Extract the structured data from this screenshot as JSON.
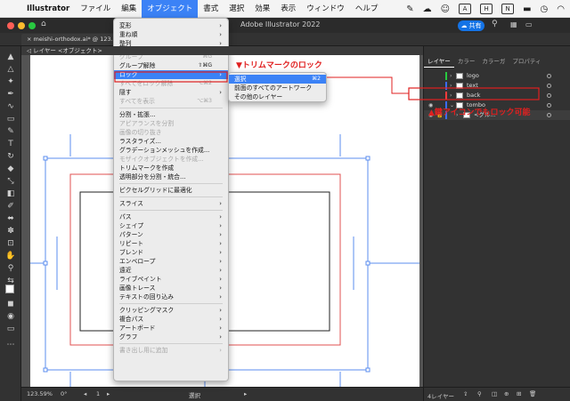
{
  "menubar": {
    "app": "Illustrator",
    "items": [
      "ファイル",
      "編集",
      "オブジェクト",
      "書式",
      "選択",
      "効果",
      "表示",
      "ウィンドウ",
      "ヘルプ"
    ],
    "active_index": 2
  },
  "window": {
    "title": "Adobe Illustrator 2022",
    "doc_tab": "meishi-orthodox.ai* @ 123.59 %",
    "breadcrumb": "レイヤー",
    "breadcrumb_sub": "<オブジェクト>",
    "share_label": "共有"
  },
  "object_menu": {
    "items": [
      {
        "label": "変形",
        "submenu": true
      },
      {
        "label": "重ね順",
        "submenu": true
      },
      {
        "label": "整列",
        "submenu": true
      },
      {
        "sep": true
      },
      {
        "label": "グループ",
        "shortcut": "⌘G",
        "disabled": true
      },
      {
        "label": "グループ解除",
        "shortcut": "⇧⌘G"
      },
      {
        "label": "ロック",
        "submenu": true,
        "highlight": true
      },
      {
        "label": "すべてをロック解除",
        "shortcut": "⌥⌘2",
        "disabled": true
      },
      {
        "label": "隠す",
        "submenu": true
      },
      {
        "label": "すべてを表示",
        "shortcut": "⌥⌘3",
        "disabled": true
      },
      {
        "sep": true
      },
      {
        "label": "分割・拡張..."
      },
      {
        "label": "アピアランスを分割",
        "disabled": true
      },
      {
        "label": "画像の切り抜き",
        "disabled": true
      },
      {
        "label": "ラスタライズ..."
      },
      {
        "label": "グラデーションメッシュを作成..."
      },
      {
        "label": "モザイクオブジェクトを作成...",
        "disabled": true
      },
      {
        "label": "トリムマークを作成"
      },
      {
        "label": "透明部分を分割・統合..."
      },
      {
        "sep": true
      },
      {
        "label": "ピクセルグリッドに最適化"
      },
      {
        "sep": true
      },
      {
        "label": "スライス",
        "submenu": true
      },
      {
        "sep": true
      },
      {
        "label": "パス",
        "submenu": true
      },
      {
        "label": "シェイプ",
        "submenu": true
      },
      {
        "label": "パターン",
        "submenu": true
      },
      {
        "label": "リピート",
        "submenu": true
      },
      {
        "label": "ブレンド",
        "submenu": true
      },
      {
        "label": "エンベロープ",
        "submenu": true
      },
      {
        "label": "遠近",
        "submenu": true
      },
      {
        "label": "ライブペイント",
        "submenu": true
      },
      {
        "label": "画像トレース",
        "submenu": true
      },
      {
        "label": "テキストの回り込み",
        "submenu": true
      },
      {
        "sep": true
      },
      {
        "label": "クリッピングマスク",
        "submenu": true
      },
      {
        "label": "複合パス",
        "submenu": true
      },
      {
        "label": "アートボード",
        "submenu": true
      },
      {
        "label": "グラフ",
        "submenu": true
      },
      {
        "sep": true
      },
      {
        "label": "書き出し用に追加",
        "submenu": true,
        "disabled": true
      }
    ]
  },
  "lock_submenu": {
    "items": [
      {
        "label": "選択",
        "shortcut": "⌘2",
        "highlight": true
      },
      {
        "label": "前面のすべてのアートワーク"
      },
      {
        "label": "その他のレイヤー"
      }
    ]
  },
  "panel": {
    "tabs": [
      "レイヤー",
      "カラー",
      "カラーガ",
      "プロパティ"
    ],
    "layers": [
      {
        "name": "logo",
        "color": "#27c93f"
      },
      {
        "name": "text",
        "color": "#3b6cff"
      },
      {
        "name": "back",
        "color": "#ff3b3b"
      },
      {
        "name": "tombo",
        "color": "#3b6cff",
        "expanded": true
      },
      {
        "name": "<グル...",
        "color": "#3b6cff",
        "locked": true,
        "sub": true
      }
    ],
    "footer": "4レイヤー"
  },
  "status": {
    "zoom": "123.59%",
    "angle": "0°",
    "page": "1",
    "mode": "選択"
  },
  "annotations": {
    "trim_lock": "▼トリムマークのロック",
    "lock_icon": "▲鍵アイコンでもロック可能"
  },
  "colors": {
    "highlight": "#3b82f6",
    "annotation": "#e02020",
    "guide_blue": "#5b8def",
    "guide_red": "#e05050"
  }
}
